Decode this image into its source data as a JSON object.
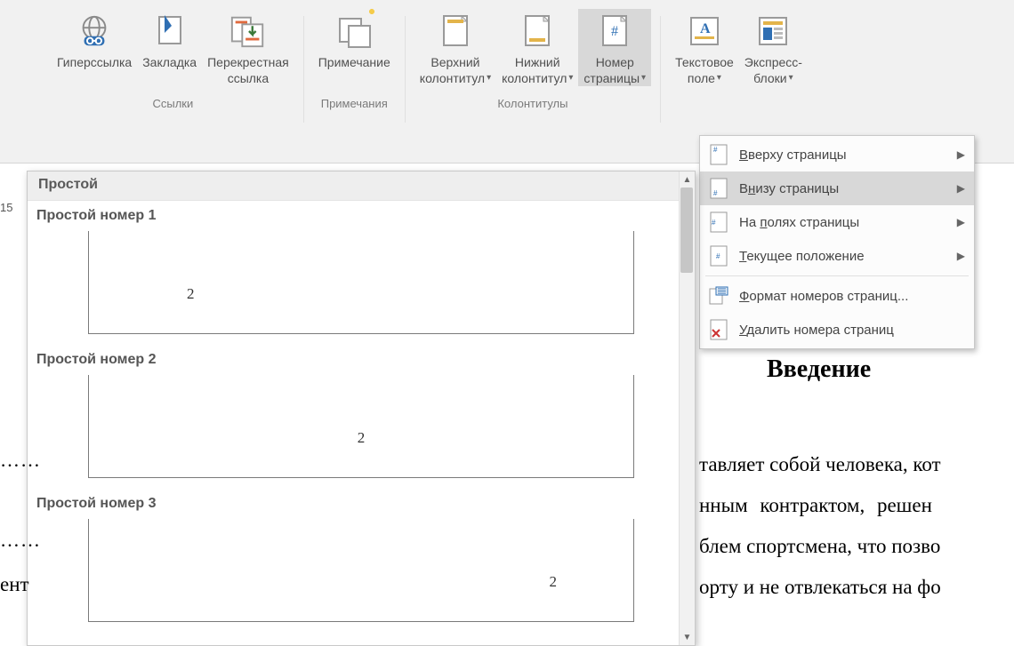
{
  "ribbon": {
    "hyperlink": {
      "label": "Гиперссылка"
    },
    "bookmark": {
      "label": "Закладка"
    },
    "crossref": {
      "label1": "Перекрестная",
      "label2": "ссылка"
    },
    "comment": {
      "label": "Примечание"
    },
    "header": {
      "label1": "Верхний",
      "label2": "колонтитул"
    },
    "footer": {
      "label1": "Нижний",
      "label2": "колонтитул"
    },
    "pagenum": {
      "label1": "Номер",
      "label2": "страницы"
    },
    "textfield": {
      "label1": "Текстовое",
      "label2": "поле"
    },
    "quickparts": {
      "label1": "Экспресс-",
      "label2": "блоки"
    },
    "groups": {
      "links": "Ссылки",
      "comments": "Примечания",
      "hf": "Колонтитулы"
    }
  },
  "menu": {
    "top": {
      "pre": "",
      "u": "В",
      "post": "верху страницы"
    },
    "bottom": {
      "pre": "В",
      "u": "н",
      "post": "изу страницы"
    },
    "margins": {
      "pre": "На ",
      "u": "п",
      "post": "олях страницы"
    },
    "current": {
      "pre": "",
      "u": "Т",
      "post": "екущее положение"
    },
    "format": {
      "pre": "",
      "u": "Ф",
      "post": "ормат номеров страниц..."
    },
    "remove": {
      "pre": "",
      "u": "У",
      "post": "далить номера страниц"
    }
  },
  "gallery": {
    "category": "Простой",
    "items": [
      {
        "title": "Простой номер 1",
        "align": "left",
        "sample": "2"
      },
      {
        "title": "Простой номер 2",
        "align": "center",
        "sample": "2"
      },
      {
        "title": "Простой номер 3",
        "align": "right",
        "sample": "2"
      }
    ]
  },
  "doc": {
    "page_indicator": "15",
    "heading": "Введение",
    "line1": "тавляет собой человека, кот",
    "line2": "нным   контрактом,   решен",
    "line3": "блем спортсмена, что позво",
    "line4": "орту и не отвлекаться на фо",
    "frag_ent": "ент",
    "dots": "……"
  }
}
